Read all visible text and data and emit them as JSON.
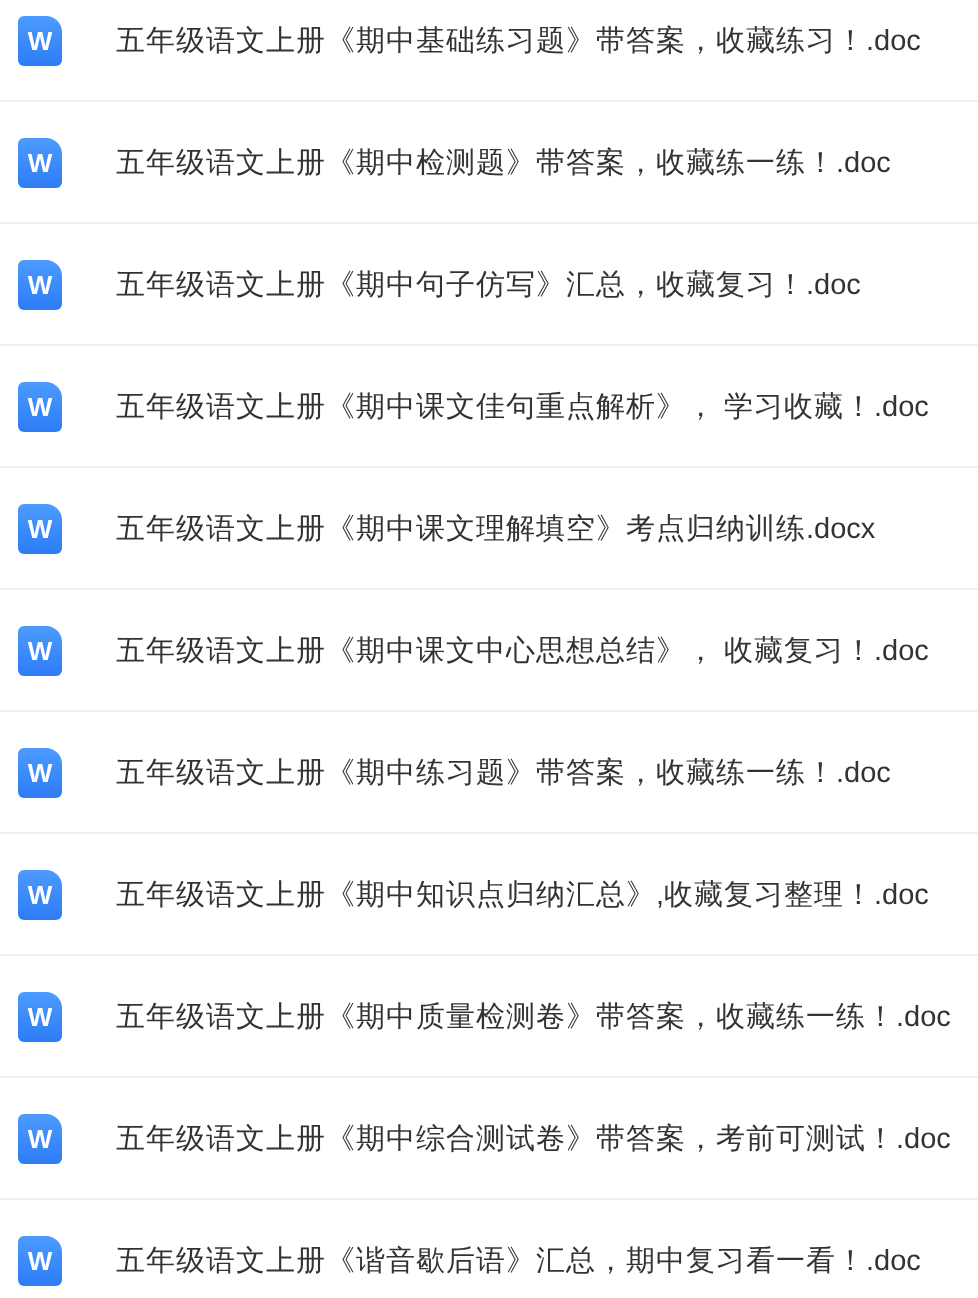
{
  "files": [
    {
      "icon": "W",
      "name": "五年级语文上册《期中基础练习题》带答案，收藏练习！.doc"
    },
    {
      "icon": "W",
      "name": "五年级语文上册《期中检测题》带答案，收藏练一练！.doc"
    },
    {
      "icon": "W",
      "name": "五年级语文上册《期中句子仿写》汇总，收藏复习！.doc"
    },
    {
      "icon": "W",
      "name": "五年级语文上册《期中课文佳句重点解析》， 学习收藏！.doc"
    },
    {
      "icon": "W",
      "name": "五年级语文上册《期中课文理解填空》考点归纳训练.docx"
    },
    {
      "icon": "W",
      "name": "五年级语文上册《期中课文中心思想总结》， 收藏复习！.doc"
    },
    {
      "icon": "W",
      "name": "五年级语文上册《期中练习题》带答案，收藏练一练！.doc"
    },
    {
      "icon": "W",
      "name": "五年级语文上册《期中知识点归纳汇总》,收藏复习整理！.doc"
    },
    {
      "icon": "W",
      "name": "五年级语文上册《期中质量检测卷》带答案，收藏练一练！.doc"
    },
    {
      "icon": "W",
      "name": "五年级语文上册《期中综合测试卷》带答案，考前可测试！.doc"
    },
    {
      "icon": "W",
      "name": "五年级语文上册《谐音歇后语》汇总，期中复习看一看！.doc"
    }
  ]
}
